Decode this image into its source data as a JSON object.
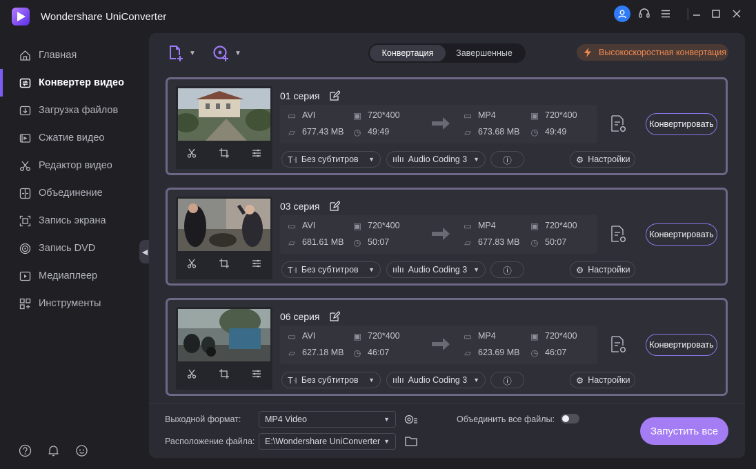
{
  "app": {
    "title": "Wondershare UniConverter"
  },
  "colors": {
    "accent": "#7b5cf5",
    "start_button": "#a47cf4",
    "high_speed": "#f08a50",
    "user_button": "#2f7cf6"
  },
  "sidebar": {
    "items": [
      {
        "label": "Главная",
        "icon": "home-icon"
      },
      {
        "label": "Конвертер видео",
        "icon": "converter-icon",
        "active": true
      },
      {
        "label": "Загрузка файлов",
        "icon": "download-icon"
      },
      {
        "label": "Сжатие видео",
        "icon": "compress-icon"
      },
      {
        "label": "Редактор видео",
        "icon": "scissors-icon"
      },
      {
        "label": "Объединение",
        "icon": "merge-icon"
      },
      {
        "label": "Запись экрана",
        "icon": "screen-record-icon"
      },
      {
        "label": "Запись DVD",
        "icon": "dvd-icon"
      },
      {
        "label": "Медиаплеер",
        "icon": "player-icon"
      },
      {
        "label": "Инструменты",
        "icon": "tools-icon"
      }
    ]
  },
  "toolbar": {
    "tabs": [
      "Конвертация",
      "Завершенные"
    ],
    "high_speed": "Высокоскоростная конвертация"
  },
  "files": [
    {
      "title": "01 серия",
      "src_format": "AVI",
      "src_res": "720*400",
      "src_size": "677.43 MB",
      "src_duration": "49:49",
      "out_format": "MP4",
      "out_res": "720*400",
      "out_size": "673.68 MB",
      "out_duration": "49:49",
      "subtitles": "Без субтитров",
      "audio": "Audio Coding 3",
      "settings": "Настройки",
      "convert": "Конвертировать"
    },
    {
      "title": "03 серия",
      "src_format": "AVI",
      "src_res": "720*400",
      "src_size": "681.61 MB",
      "src_duration": "50:07",
      "out_format": "MP4",
      "out_res": "720*400",
      "out_size": "677.83 MB",
      "out_duration": "50:07",
      "subtitles": "Без субтитров",
      "audio": "Audio Coding 3",
      "settings": "Настройки",
      "convert": "Конвертировать"
    },
    {
      "title": "06 серия",
      "src_format": "AVI",
      "src_res": "720*400",
      "src_size": "627.18 MB",
      "src_duration": "46:07",
      "out_format": "MP4",
      "out_res": "720*400",
      "out_size": "623.69 MB",
      "out_duration": "46:07",
      "subtitles": "Без субтитров",
      "audio": "Audio Coding 3",
      "settings": "Настройки",
      "convert": "Конвертировать"
    }
  ],
  "bottom": {
    "output_format_label": "Выходной формат:",
    "output_format_value": "MP4 Video",
    "merge_label": "Объединить все файлы:",
    "merge_enabled": false,
    "location_label": "Расположение файла:",
    "location_value": "E:\\Wondershare UniConverter",
    "start_all": "Запустить все"
  }
}
